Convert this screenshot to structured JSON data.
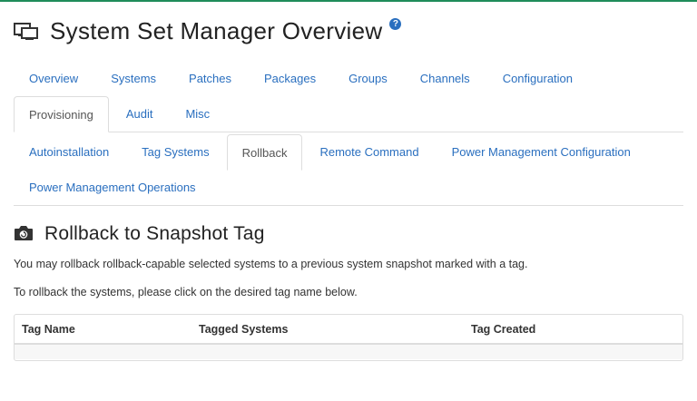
{
  "header": {
    "title": "System Set Manager Overview",
    "help_glyph": "?",
    "icon": "monitor-icon"
  },
  "main_tabs": [
    {
      "label": "Overview",
      "active": false
    },
    {
      "label": "Systems",
      "active": false
    },
    {
      "label": "Patches",
      "active": false
    },
    {
      "label": "Packages",
      "active": false
    },
    {
      "label": "Groups",
      "active": false
    },
    {
      "label": "Channels",
      "active": false
    },
    {
      "label": "Configuration",
      "active": false
    },
    {
      "label": "Provisioning",
      "active": true
    },
    {
      "label": "Audit",
      "active": false
    },
    {
      "label": "Misc",
      "active": false
    }
  ],
  "sub_tabs": [
    {
      "label": "Autoinstallation",
      "active": false
    },
    {
      "label": "Tag Systems",
      "active": false
    },
    {
      "label": "Rollback",
      "active": true
    },
    {
      "label": "Remote Command",
      "active": false
    },
    {
      "label": "Power Management Configuration",
      "active": false
    },
    {
      "label": "Power Management Operations",
      "active": false
    }
  ],
  "section": {
    "title": "Rollback to Snapshot Tag",
    "icon": "camera-icon",
    "description": "You may rollback rollback-capable selected systems to a previous system snapshot marked with a tag.",
    "instruction": "To rollback the systems, please click on the desired tag name below."
  },
  "table": {
    "columns": [
      "Tag Name",
      "Tagged Systems",
      "Tag Created"
    ],
    "rows": []
  },
  "colors": {
    "link": "#2a6fbf",
    "accent": "#1f8c5a",
    "border": "#dddddd"
  }
}
